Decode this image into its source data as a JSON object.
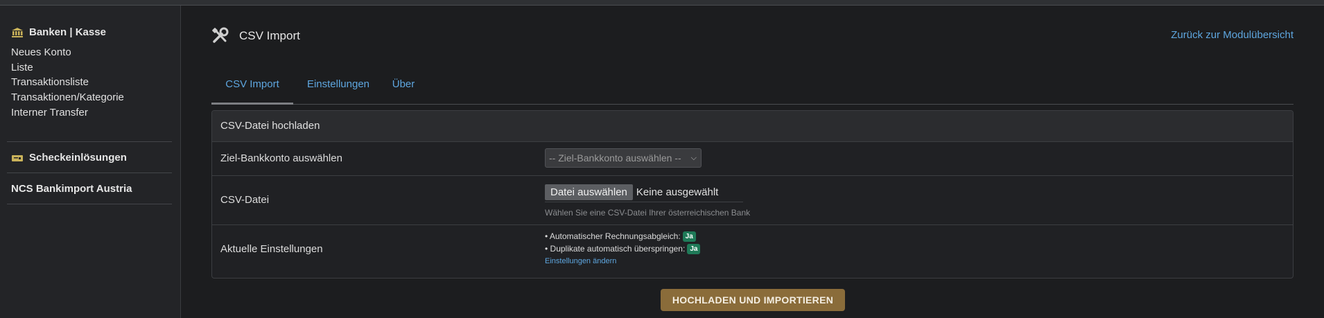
{
  "sidebar": {
    "section_banks": "Banken | Kasse",
    "items": [
      "Neues Konto",
      "Liste",
      "Transaktionsliste",
      "Transaktionen/Kategorie",
      "Interner Transfer"
    ],
    "section_checks": "Scheckeinlösungen",
    "section_import": "NCS Bankimport Austria"
  },
  "header": {
    "title": "CSV Import",
    "back_link": "Zurück zur Modulübersicht"
  },
  "tabs": [
    {
      "label": "CSV Import",
      "active": true
    },
    {
      "label": "Einstellungen",
      "active": false
    },
    {
      "label": "Über",
      "active": false
    }
  ],
  "panel": {
    "title": "CSV-Datei hochladen",
    "bank_label": "Ziel-Bankkonto auswählen",
    "bank_select": "-- Ziel-Bankkonto auswählen --",
    "file_label": "CSV-Datei",
    "file_button": "Datei auswählen",
    "file_status": "Keine ausgewählt",
    "file_hint": "Wählen Sie eine CSV-Datei Ihrer österreichischen Bank",
    "settings_label": "Aktuelle Einstellungen",
    "setting_1": "• Automatischer Rechnungsabgleich:",
    "setting_1_value": "Ja",
    "setting_2": "• Duplikate automatisch überspringen:",
    "setting_2_value": "Ja",
    "settings_link": "Einstellungen ändern"
  },
  "submit_label": "HOCHLADEN UND IMPORTIEREN",
  "colors": {
    "accent_link": "#5ea6df",
    "badge": "#1f7a58",
    "submit": "#8a6c3a"
  }
}
